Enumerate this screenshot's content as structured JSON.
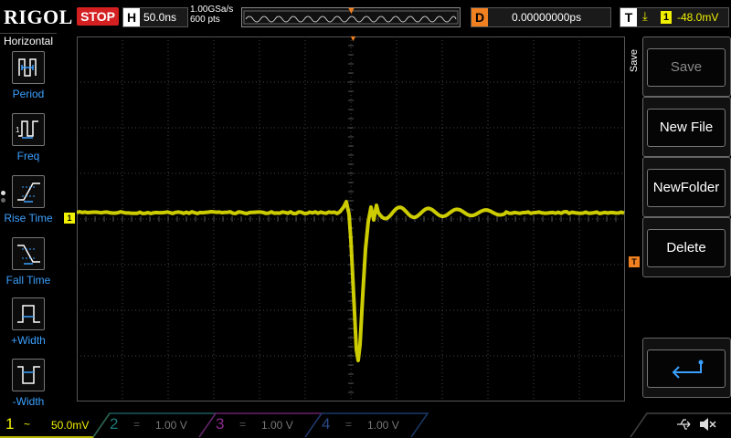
{
  "topbar": {
    "logo": "RIGOL",
    "run_state": "STOP",
    "horizontal_tag": "H",
    "timebase": "50.0ns",
    "sample_rate": "1.00GSa/s",
    "memory_depth": "600 pts",
    "delay_tag": "D",
    "delay_value": "0.00000000ps",
    "trigger_tag": "T",
    "trigger_source": "1",
    "trigger_level": "-48.0mV"
  },
  "left_menu": {
    "title": "Horizontal",
    "items": [
      {
        "label": "Period",
        "icon": "period-icon"
      },
      {
        "label": "Freq",
        "icon": "frequency-icon"
      },
      {
        "label": "Rise Time",
        "icon": "rise-time-icon"
      },
      {
        "label": "Fall Time",
        "icon": "fall-time-icon"
      },
      {
        "label": "+Width",
        "icon": "positive-width-icon"
      },
      {
        "label": "-Width",
        "icon": "negative-width-icon"
      }
    ]
  },
  "right_menu": {
    "title": "Save",
    "buttons": [
      "Save",
      "New File",
      "NewFolder",
      "Delete"
    ],
    "return_icon": "return-arrow-icon"
  },
  "screen": {
    "ch1_marker": "1",
    "trigger_marker": "T"
  },
  "channels": [
    {
      "num": "1",
      "coupling": "~",
      "scale": "50.0mV",
      "color": "#f0f000",
      "active": true
    },
    {
      "num": "2",
      "coupling": "=",
      "scale": "1.00 V",
      "color": "#1a7a7a",
      "active": false
    },
    {
      "num": "3",
      "coupling": "=",
      "scale": "1.00 V",
      "color": "#8a2a8a",
      "active": false
    },
    {
      "num": "4",
      "coupling": "=",
      "scale": "1.00 V",
      "color": "#2a4a8a",
      "active": false
    }
  ],
  "colors": {
    "trace": "#f0f000",
    "accent": "#f08020",
    "menu_label": "#3aa0ff"
  }
}
